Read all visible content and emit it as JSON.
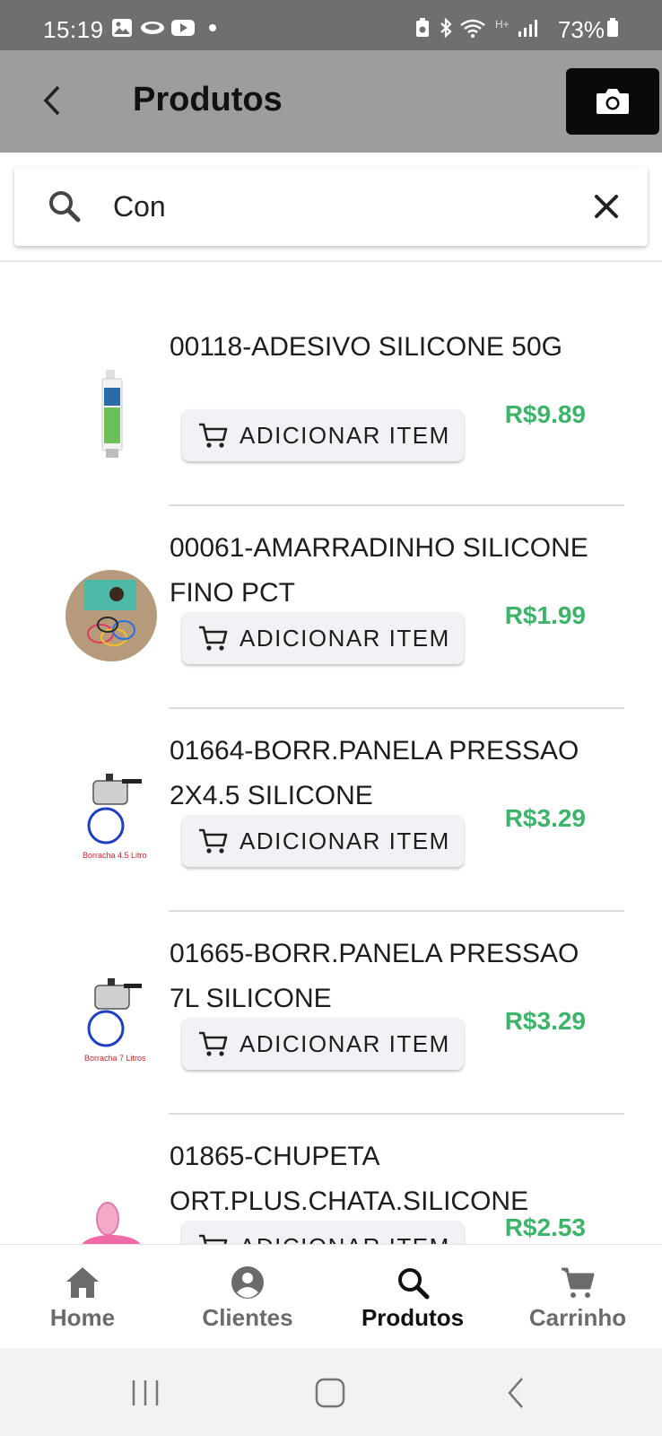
{
  "status_bar": {
    "time": "15:19",
    "battery": "73%",
    "network_label": "H+",
    "icons": [
      "image-icon",
      "cloud-icon",
      "youtube-icon",
      "dot-icon",
      "battery-saver-icon",
      "bluetooth-icon",
      "wifi-icon",
      "signal-icon",
      "battery-icon"
    ]
  },
  "app_bar": {
    "title": "Produtos",
    "back_icon": "chevron-left-icon",
    "camera_icon": "camera-icon"
  },
  "search": {
    "value": "Con",
    "icon": "search-icon",
    "clear_icon": "close-icon"
  },
  "products": [
    {
      "name": "00118-ADESIVO SILICONE 50G",
      "price": "R$9.89",
      "button_label": "ADICIONAR ITEM",
      "thumb": "silicone-tube-thumbnail",
      "thumb_caption": ""
    },
    {
      "name": "00061-AMARRADINHO SILICONE FINO PCT",
      "price": "R$1.99",
      "button_label": "ADICIONAR ITEM",
      "thumb": "hair-ties-thumbnail",
      "thumb_caption": ""
    },
    {
      "name": "01664-BORR.PANELA PRESSAO 2X4.5 SILICONE",
      "price": "R$3.29",
      "button_label": "ADICIONAR ITEM",
      "thumb": "pressure-cooker-ring-thumbnail",
      "thumb_caption": "Borracha 4.5 Litro"
    },
    {
      "name": "01665-BORR.PANELA PRESSAO 7L SILICONE",
      "price": "R$3.29",
      "button_label": "ADICIONAR ITEM",
      "thumb": "pressure-cooker-ring-thumbnail",
      "thumb_caption": "Borracha 7 Litros"
    },
    {
      "name": "01865-CHUPETA ORT.PLUS.CHATA.SILICONE",
      "price": "R$2.53",
      "button_label": "ADICIONAR ITEM",
      "thumb": "pacifier-thumbnail",
      "thumb_caption": ""
    }
  ],
  "bottom_nav": [
    {
      "label": "Home",
      "icon": "home-icon",
      "active": false
    },
    {
      "label": "Clientes",
      "icon": "account-circle-icon",
      "active": false
    },
    {
      "label": "Produtos",
      "icon": "search-icon",
      "active": true
    },
    {
      "label": "Carrinho",
      "icon": "cart-icon",
      "active": false
    }
  ],
  "system_nav": [
    "recents-icon",
    "home-square-icon",
    "back-arrow-icon"
  ],
  "colors": {
    "status_bar": "#6f6f6f",
    "app_bar": "#9d9d9d",
    "camera_button": "#0a0a0a",
    "price": "#3fb36a",
    "button_bg": "#f2f2f6",
    "nav_inactive": "#6b6b6b",
    "nav_active": "#111111"
  }
}
